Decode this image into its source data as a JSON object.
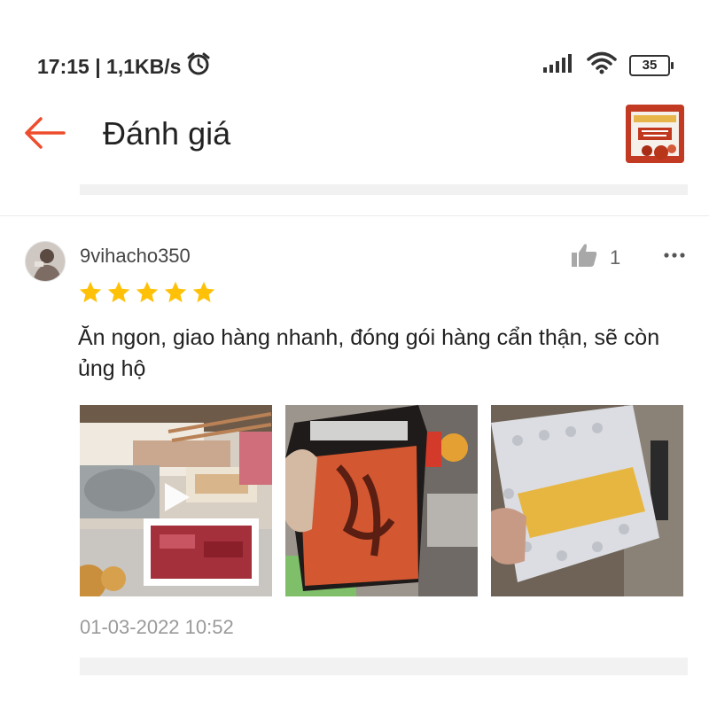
{
  "status_bar": {
    "time_speed": "17:15 | 1,1KB/s",
    "battery": "35",
    "icons": [
      "alarm-icon",
      "signal-icon",
      "wifi-icon",
      "battery-icon"
    ]
  },
  "header": {
    "title": "Đánh giá",
    "back_icon": "arrow-left-icon",
    "accent_color": "#ee4d2d"
  },
  "review": {
    "username": "9vihacho350",
    "rating": 5,
    "like_count": "1",
    "text": "Ăn ngon, giao hàng nhanh, đóng gói hàng cẩn thận, sẽ còn ủng hộ",
    "date": "01-03-2022 10:52",
    "media": [
      {
        "kind": "video",
        "subject": "hotpot-meal"
      },
      {
        "kind": "photo",
        "subject": "hotpot-package"
      },
      {
        "kind": "photo",
        "subject": "bubble-wrap-parcel"
      }
    ],
    "star_color": "#ffc107"
  }
}
